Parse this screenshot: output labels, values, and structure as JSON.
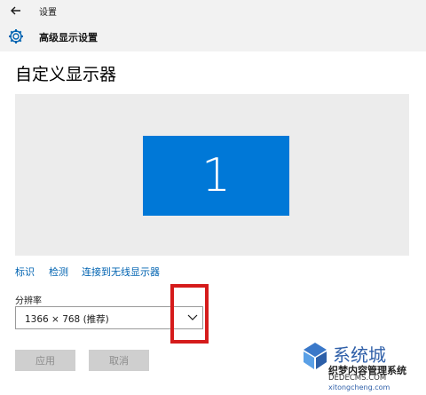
{
  "titlebar": {
    "title": "设置"
  },
  "header": {
    "title": "高级显示设置"
  },
  "page": {
    "title": "自定义显示器"
  },
  "display": {
    "monitor_number": "1"
  },
  "links": {
    "identify": "标识",
    "detect": "检测",
    "wireless": "连接到无线显示器"
  },
  "resolution": {
    "label": "分辨率",
    "value": "1366 × 768 (推荐)"
  },
  "buttons": {
    "apply": "应用",
    "cancel": "取消"
  },
  "watermark": {
    "brand_cn": "系统城",
    "line1": "织梦内容管理系统",
    "line2": "DEDECMS.COM",
    "line3": "xitongcheng.com"
  },
  "colors": {
    "accent": "#0078d7",
    "link": "#0063b1",
    "highlight": "#d51b1b"
  },
  "icons": [
    "back-arrow-icon",
    "gear-icon",
    "chevron-down-icon"
  ]
}
